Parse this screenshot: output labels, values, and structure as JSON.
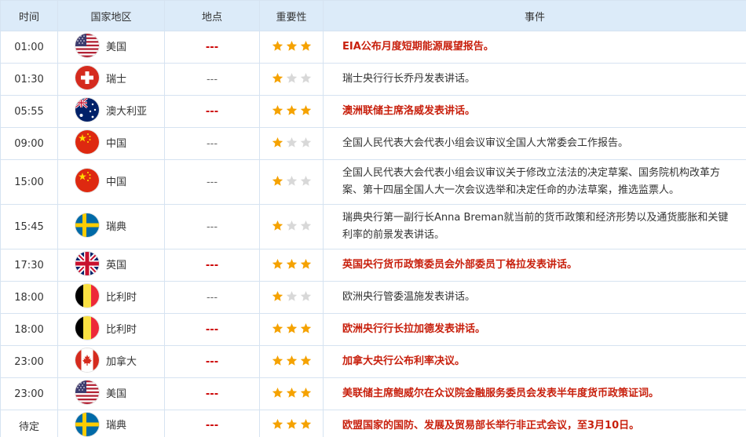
{
  "header": {
    "time": "时间",
    "country": "国家地区",
    "location": "地点",
    "importance": "重要性",
    "event": "事件"
  },
  "colors": {
    "star_on": "#f5a200",
    "star_off": "#d8d8d8",
    "important_text": "#c8200d",
    "header_bg": "#dcebf9",
    "border": "#d6e3f1"
  },
  "rows": [
    {
      "time": "01:00",
      "flag": "us-flag-icon",
      "country": "美国",
      "location": "---",
      "stars": 3,
      "event": "EIA公布月度短期能源展望报告。"
    },
    {
      "time": "01:30",
      "flag": "switzerland-flag-icon",
      "country": "瑞士",
      "location": "---",
      "stars": 1,
      "event": "瑞士央行行长乔丹发表讲话。"
    },
    {
      "time": "05:55",
      "flag": "australia-flag-icon",
      "country": "澳大利亚",
      "location": "---",
      "stars": 3,
      "event": "澳洲联储主席洛威发表讲话。"
    },
    {
      "time": "09:00",
      "flag": "china-flag-icon",
      "country": "中国",
      "location": "---",
      "stars": 1,
      "event": "全国人民代表大会代表小组会议审议全国人大常委会工作报告。"
    },
    {
      "time": "15:00",
      "flag": "china-flag-icon",
      "country": "中国",
      "location": "---",
      "stars": 1,
      "event": "全国人民代表大会代表小组会议审议关于修改立法法的决定草案、国务院机构改革方案、第十四届全国人大一次会议选举和决定任命的办法草案，推选监票人。"
    },
    {
      "time": "15:45",
      "flag": "sweden-flag-icon",
      "country": "瑞典",
      "location": "---",
      "stars": 1,
      "event": "瑞典央行第一副行长Anna Breman就当前的货币政策和经济形势以及通货膨胀和关键利率的前景发表讲话。"
    },
    {
      "time": "17:30",
      "flag": "uk-flag-icon",
      "country": "英国",
      "location": "---",
      "stars": 3,
      "event": "英国央行货币政策委员会外部委员丁格拉发表讲话。"
    },
    {
      "time": "18:00",
      "flag": "belgium-flag-icon",
      "country": "比利时",
      "location": "---",
      "stars": 1,
      "event": "欧洲央行管委温施发表讲话。"
    },
    {
      "time": "18:00",
      "flag": "belgium-flag-icon",
      "country": "比利时",
      "location": "---",
      "stars": 3,
      "event": "欧洲央行行长拉加德发表讲话。"
    },
    {
      "time": "23:00",
      "flag": "canada-flag-icon",
      "country": "加拿大",
      "location": "---",
      "stars": 3,
      "event": "加拿大央行公布利率决议。"
    },
    {
      "time": "23:00",
      "flag": "us-flag-icon",
      "country": "美国",
      "location": "---",
      "stars": 3,
      "event": "美联储主席鲍威尔在众议院金融服务委员会发表半年度货币政策证词。"
    },
    {
      "time": "待定",
      "flag": "sweden-flag-icon",
      "country": "瑞典",
      "location": "---",
      "stars": 3,
      "event": "欧盟国家的国防、发展及贸易部长举行非正式会议，至3月10日。"
    }
  ]
}
